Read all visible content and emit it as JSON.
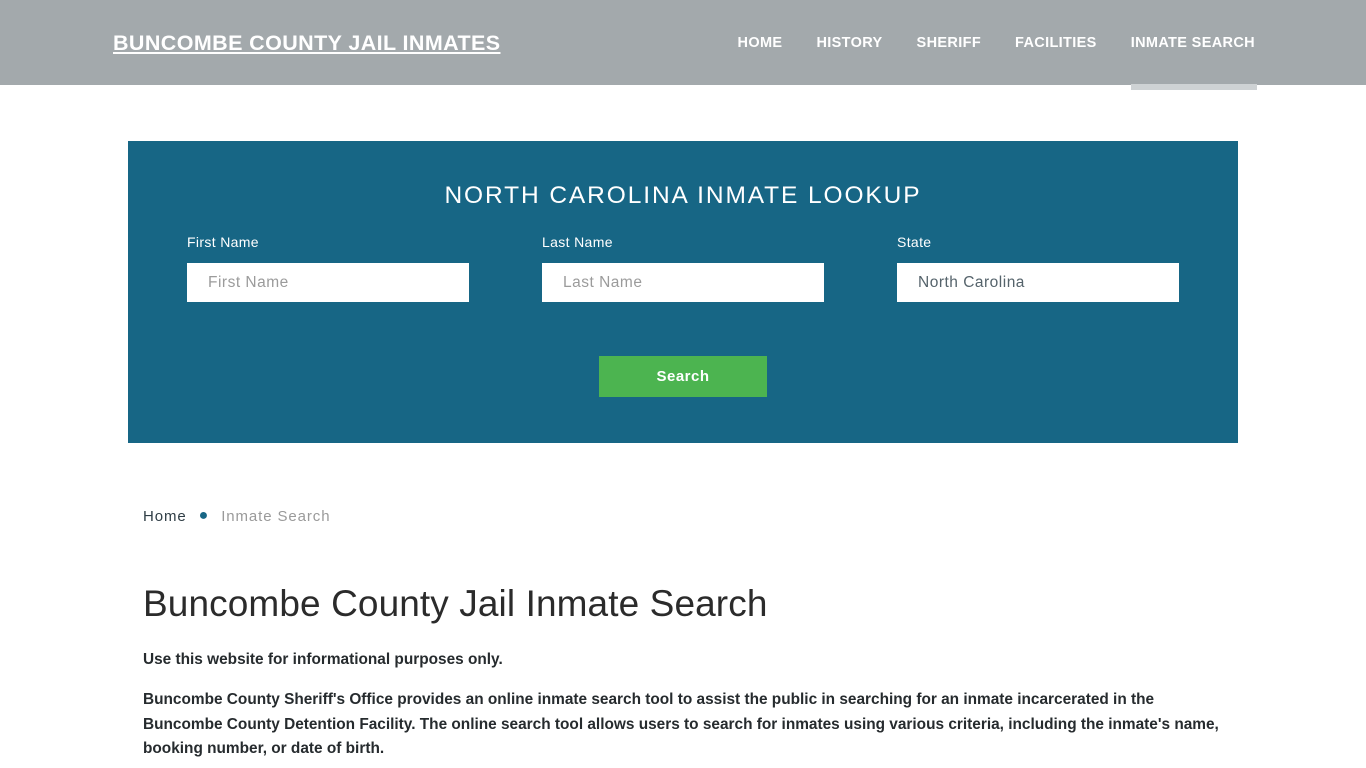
{
  "header": {
    "brand": "BUNCOMBE COUNTY JAIL INMATES",
    "nav": [
      {
        "label": "HOME",
        "active": false
      },
      {
        "label": "HISTORY",
        "active": false
      },
      {
        "label": "SHERIFF",
        "active": false
      },
      {
        "label": "FACILITIES",
        "active": false
      },
      {
        "label": "INMATE SEARCH",
        "active": true
      }
    ],
    "background_color": "#a3a9ac",
    "active_underline_color": "#ced2d4"
  },
  "search_panel": {
    "title": "NORTH CAROLINA INMATE LOOKUP",
    "background_color": "#176685",
    "fields": {
      "first_name": {
        "label": "First Name",
        "placeholder": "First Name",
        "value": ""
      },
      "last_name": {
        "label": "Last Name",
        "placeholder": "Last Name",
        "value": ""
      },
      "state": {
        "label": "State",
        "placeholder": "State",
        "value": "North Carolina"
      }
    },
    "submit": {
      "label": "Search",
      "color": "#4cb450"
    }
  },
  "breadcrumb": {
    "home": "Home",
    "separator": "●",
    "current": "Inmate Search"
  },
  "main": {
    "title": "Buncombe County Jail Inmate Search",
    "paragraphs": [
      "Use this website for informational purposes only.",
      "Buncombe County Sheriff's Office provides an online inmate search tool to assist the public in searching for an inmate incarcerated in the Buncombe County Detention Facility. The online search tool allows users to search for inmates using various criteria, including the inmate's name, booking number, or date of birth."
    ]
  }
}
